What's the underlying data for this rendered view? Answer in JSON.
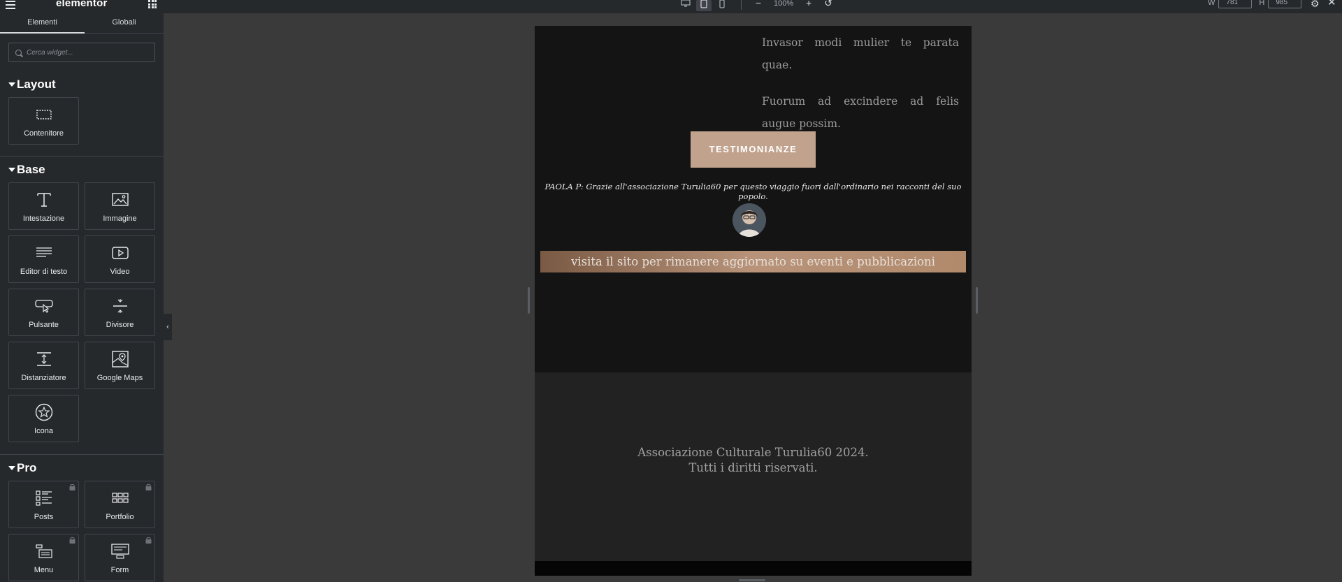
{
  "topbar": {
    "logo": "elementor",
    "zoom": "100%",
    "width_label": "W",
    "width_value": "781",
    "height_label": "H",
    "height_value": "985"
  },
  "sidebar": {
    "tabs": [
      {
        "label": "Elementi",
        "active": true
      },
      {
        "label": "Globali",
        "active": false
      }
    ],
    "search": {
      "placeholder": "Cerca widget..."
    },
    "categories": {
      "layout": {
        "title": "Layout",
        "widgets": [
          {
            "label": "Contenitore",
            "icon": "container-icon"
          }
        ]
      },
      "base": {
        "title": "Base",
        "widgets": [
          {
            "label": "Intestazione",
            "icon": "heading-icon"
          },
          {
            "label": "Immagine",
            "icon": "image-icon"
          },
          {
            "label": "Editor di testo",
            "icon": "text-editor-icon"
          },
          {
            "label": "Video",
            "icon": "video-icon"
          },
          {
            "label": "Pulsante",
            "icon": "button-icon"
          },
          {
            "label": "Divisore",
            "icon": "divider-icon"
          },
          {
            "label": "Distanziatore",
            "icon": "spacer-icon"
          },
          {
            "label": "Google Maps",
            "icon": "map-icon"
          },
          {
            "label": "Icona",
            "icon": "star-icon"
          }
        ]
      },
      "pro": {
        "title": "Pro",
        "widgets": [
          {
            "label": "Posts",
            "icon": "posts-icon",
            "locked": true
          },
          {
            "label": "Portfolio",
            "icon": "portfolio-icon",
            "locked": true
          },
          {
            "label": "Menu",
            "icon": "menu-icon",
            "locked": true
          },
          {
            "label": "Form",
            "icon": "form-icon",
            "locked": true
          }
        ]
      }
    }
  },
  "canvas": {
    "paragraphs": [
      "Invasor modi mulier te parata quae.",
      "Fuorum ad excindere ad felis augue possim."
    ],
    "button": "TESTIMONIANZE",
    "testimonial": "PAOLA P: Grazie all'associazione Turulia60 per questo viaggio fuori dall'ordinario nei racconti del suo popolo.",
    "banner": "visita il sito per rimanere aggiornato su eventi e pubblicazioni",
    "footer": {
      "line1": "Associazione Culturale Turulia60 2024.",
      "line2": "Tutti i diritti riservati."
    }
  },
  "colors": {
    "panel": "#26292c",
    "workspace": "#3a3a3a",
    "page_bg": "#141414",
    "footer_bg": "#222222",
    "accent_button": "#c1a28c"
  }
}
